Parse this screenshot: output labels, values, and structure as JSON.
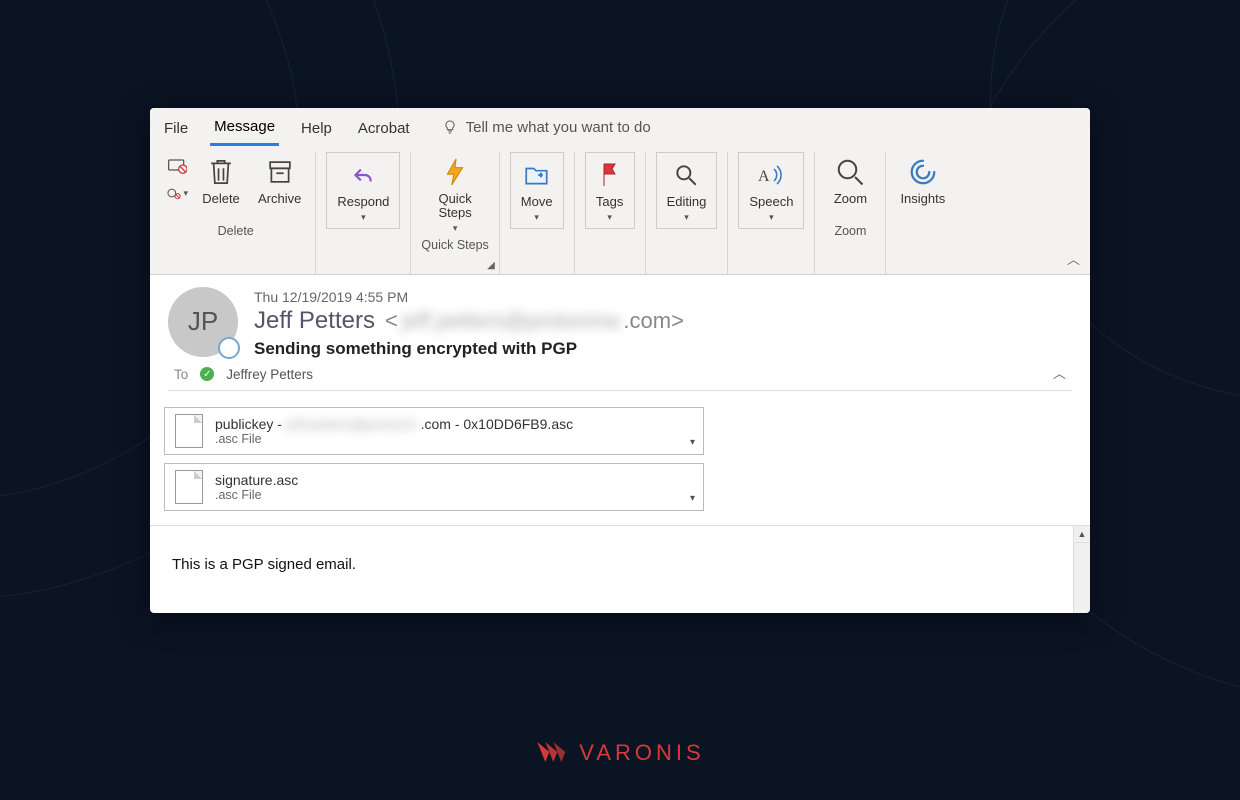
{
  "menu": {
    "file": "File",
    "message": "Message",
    "help": "Help",
    "acrobat": "Acrobat",
    "tellme": "Tell me what you want to do"
  },
  "ribbon": {
    "delete_group": "Delete",
    "delete": "Delete",
    "archive": "Archive",
    "respond": "Respond",
    "quick_steps_group": "Quick Steps",
    "quick_steps": "Quick\nSteps",
    "move": "Move",
    "tags": "Tags",
    "editing": "Editing",
    "speech": "Speech",
    "zoom_group": "Zoom",
    "zoom": "Zoom",
    "insights": "Insights"
  },
  "message": {
    "avatar_initials": "JP",
    "timestamp": "Thu 12/19/2019 4:55 PM",
    "from_name": "Jeff Petters",
    "from_email_prefix": "<",
    "from_email_blurred": "jeff.petters@protonma",
    "from_email_suffix": ".com>",
    "subject": "Sending something encrypted with PGP",
    "to_label": "To",
    "to_name": "Jeffrey Petters",
    "body": "This is a PGP signed email."
  },
  "attachments": [
    {
      "name_prefix": "publickey - ",
      "name_blurred": "jeff.petters@protonm",
      "name_suffix": ".com - 0x10DD6FB9.asc",
      "type": ".asc File"
    },
    {
      "name_prefix": "signature.asc",
      "name_blurred": "",
      "name_suffix": "",
      "type": ".asc File"
    }
  ],
  "brand": "VARONIS"
}
